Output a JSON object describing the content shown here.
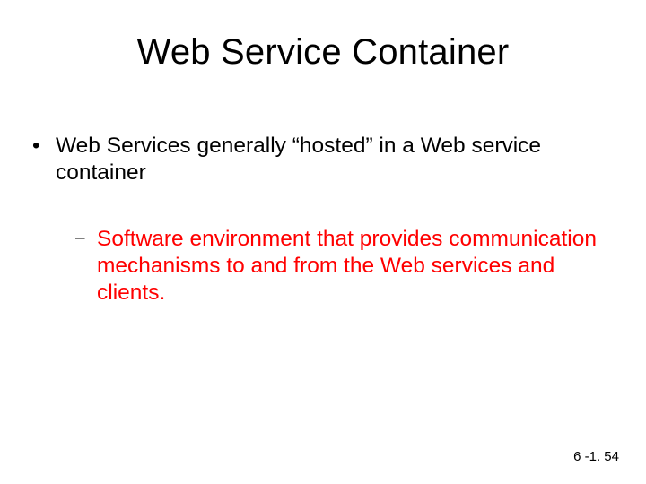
{
  "title": "Web Service Container",
  "bullets": {
    "lvl1_marker": "•",
    "lvl1_text": "Web Services generally “hosted” in a Web service container",
    "lvl2_marker": "–",
    "lvl2_text": "Software environment that provides communication mechanisms to and from the Web services and clients."
  },
  "footer": "6 -1. 54"
}
